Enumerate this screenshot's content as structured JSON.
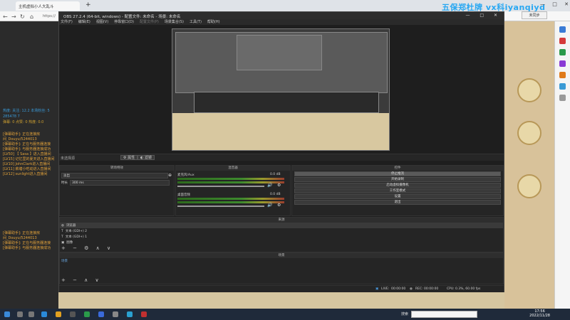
{
  "browser": {
    "tab_title": "主机虚拟小人大乱斗",
    "url_prefix": "https://",
    "watermark": "五保郑杜牌 vx科iyanqiyd",
    "right_button": "未同步"
  },
  "obs": {
    "title": "OBS 27.2.4 (64-bit, windows) - 配置文件: 未命名 - 场景: 未命名",
    "menu": [
      "文件(F)",
      "编辑(E)",
      "视图(V)",
      "停靠窗口(D)",
      "配置文件(P)",
      "场景集合(S)",
      "工具(T)",
      "帮助(H)"
    ],
    "controls_row": {
      "label": "未选择源",
      "properties": "属性",
      "filters": "滤镜"
    },
    "transitions": {
      "header": "转场特效",
      "fade_label": "淡出",
      "duration_label": "时长",
      "duration_value": "300 ms"
    },
    "mixer": {
      "header": "混音器",
      "tracks": [
        {
          "name": "麦克风/Aux",
          "db": "0.0 dB"
        },
        {
          "name": "桌面音频",
          "db": "0.0 dB"
        }
      ]
    },
    "controls": {
      "header": "控件",
      "buttons": [
        "停止推流",
        "开始录制",
        "启动虚拟摄像机",
        "工作室模式",
        "设置",
        "退出"
      ]
    },
    "sources": {
      "header": "来源",
      "items": [
        "浏览器",
        "文本 (GDI+) 2",
        "文本 (GDI+) 1",
        "图像"
      ]
    },
    "scenes": {
      "header": "场景",
      "items": [
        "场景"
      ]
    },
    "status": {
      "live_label": "LIVE:",
      "live_time": "00:00:00",
      "rec_label": "REC:",
      "rec_time": "00:00:00",
      "cpu_label": "CPU:",
      "cpu_value": "0.3%, 60.00 fps"
    }
  },
  "chat": {
    "stats": {
      "line1": "热度: 关注: 12.2 本场粉丝: 5",
      "line2": "285478 7",
      "line3": "弹幕: 0 点赞: 0 热度: 0.0"
    },
    "lines_top": [
      "[弹幕助手]: 正在连接房",
      "间_Douyu/5244013",
      "[弹幕助手]: 正在与服务器连接",
      "[弹幕助手]: 与服务器连接成功",
      "[LV50] 【 Sasa 】进入直播间",
      "[LV15] 记忆里的夏天进入直播间",
      "[LV10] JohnClark进入直播间",
      "[LV11] 薪塘小吃动进入直播间",
      "[LV12] sunlight进入直播间"
    ],
    "lines_bottom": [
      "[弹幕助手]: 正在连接房",
      "间_Douyu/5244013",
      "[弹幕助手]: 正在与服务器连接",
      "[弹幕助手]: 与服务器连接成功"
    ]
  },
  "taskbar": {
    "search_label": "搜索",
    "time": "17:56",
    "date": "2022/11/28"
  },
  "colors": {
    "obs_bg": "#1e1e1e",
    "chat_orange": "#e2a23a",
    "chat_blue": "#3a9ad9",
    "watermark": "#27a7f2"
  }
}
